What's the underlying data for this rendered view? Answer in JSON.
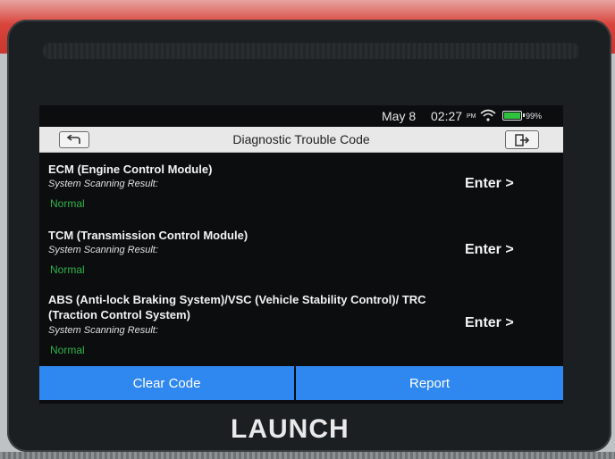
{
  "status_bar": {
    "date": "May 8",
    "time": "02:27",
    "ampm": "PM",
    "battery": "99%"
  },
  "header": {
    "title": "Diagnostic Trouble Code"
  },
  "systems": [
    {
      "name": "ECM (Engine Control Module)",
      "result_label": "System Scanning Result:",
      "result": "Normal",
      "action": "Enter >"
    },
    {
      "name": "TCM (Transmission Control Module)",
      "result_label": "System Scanning Result:",
      "result": "Normal",
      "action": "Enter >"
    },
    {
      "name": "ABS (Anti-lock Braking System)/VSC (Vehicle Stability Control)/ TRC (Traction Control System)",
      "result_label": "System Scanning Result:",
      "result": "Normal",
      "action": "Enter >"
    }
  ],
  "buttons": {
    "clear_code": "Clear Code",
    "report": "Report"
  },
  "brand": "LAUNCH",
  "colors": {
    "button_blue": "#2f88f0",
    "normal_green": "#2fb34a",
    "battery_green": "#2fc23f"
  },
  "icons": {
    "back": "back-arrow-icon",
    "exit": "exit-icon",
    "wifi": "wifi-icon",
    "battery": "battery-icon"
  }
}
